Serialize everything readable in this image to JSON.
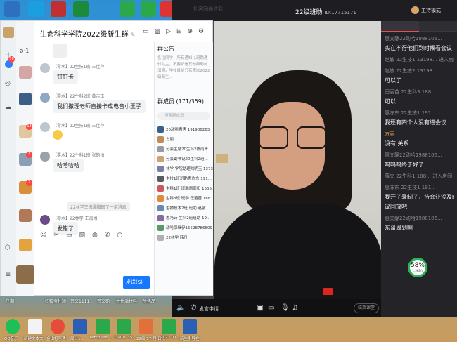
{
  "desktop": {
    "top_labels": [
      "户期",
      "积粒宝扑颖",
      "荒文1111",
      "荒文鹅",
      "生性活材料",
      "生色品"
    ],
    "left_labels": [
      "浅窗"
    ]
  },
  "live": {
    "room_title": "22级班助",
    "room_id": "ID:17715171",
    "mode_label": "主持模式",
    "ghost_title": "扎客同通信我",
    "controls": {
      "mic_label": "发言申请",
      "end_label": "结束课堂"
    },
    "chat": [
      {
        "user": "惠文静22动哈1988106...",
        "text": "实在不行他们到时候看会议"
      },
      {
        "user": "赵敏 22生技1 13198...",
        "text": "进入房间"
      },
      {
        "user": "赵敏 22生技2 13198...",
        "text": "可以了"
      },
      {
        "user": "田丽苗 22生科3 188...",
        "text": "可以"
      },
      {
        "user": "惠冻东 22生技1 191...",
        "text": "我还有四个人没有进会议"
      },
      {
        "user": "方丽",
        "text": "没有 关系"
      },
      {
        "user": "惠文静22动哈1988106...",
        "text": "呜呜呜终于好了"
      },
      {
        "user": "薛文 22生科1 188...",
        "text": "进入房间"
      },
      {
        "user": "惠冻东 22生技1 191...",
        "text": "我开了录制了，待会让没及时进来的同学"
      },
      {
        "user": "",
        "text": "议回放吧"
      },
      {
        "user": "惠文静22动哈1988106...",
        "text": "东哥周到啊"
      }
    ],
    "net_badge": {
      "percent": "58%",
      "speed": "1.5KB/s"
    }
  },
  "qq": {
    "title": "生命科学学院2022级新生群",
    "unread_counts": [
      "76",
      "13",
      "4",
      "2"
    ],
    "messages": [
      {
        "name": "",
        "text": ""
      },
      {
        "name": "【零水】22生技1班 王佳萍",
        "text": "钉钉卡"
      },
      {
        "name": "【零水】22生科2班 黄吉玉",
        "text": "我们撤理老师直接卡成电音小王子"
      },
      {
        "name": "【零水】22生技1班 王佳萍",
        "text": ""
      },
      {
        "name": "【零水】22生科1班 张的拍",
        "text": "哈哈哈哈"
      },
      {
        "name": "【零水】22林学 王海湘",
        "text": "发错了"
      }
    ],
    "system_msg": "22林学王海湘撤回了一条消息",
    "send_label": "发送(S)",
    "group": {
      "notice_title": "群公告",
      "notice_text": "各位同学，所有通知以班助通知为主，不要听信其他群聊的消息。学校目前只有惠冻2022级新生...",
      "members_title": "群成员 (171/359)",
      "search_placeholder": "搜索群成员",
      "members": [
        "20动哈惠秀 191986263",
        "方丽",
        "分会主席20生科2陈雨青",
        "分会副书记20生科2班...",
        "林学 学院助理刘明玉 13739...",
        "生技1班班助惠冻东 191...",
        "生科1班 班助惠家扣 1555...",
        "生科3班 班助 任苗苗 188...",
        "生物技术2班 班助 赵敏",
        "惠冯诗 生科2班班助 19...",
        "动哈邵继伊15528786609",
        "22林学 韩丹"
      ]
    }
  },
  "taskbar": {
    "labels": [
      "QQ音乐",
      "新建文本文...",
      "金山打字通",
      "周计1...",
      "template_...",
      "16801 35...",
      "22级 17 届 日...",
      "2022 07...",
      "新生引导在..."
    ]
  }
}
